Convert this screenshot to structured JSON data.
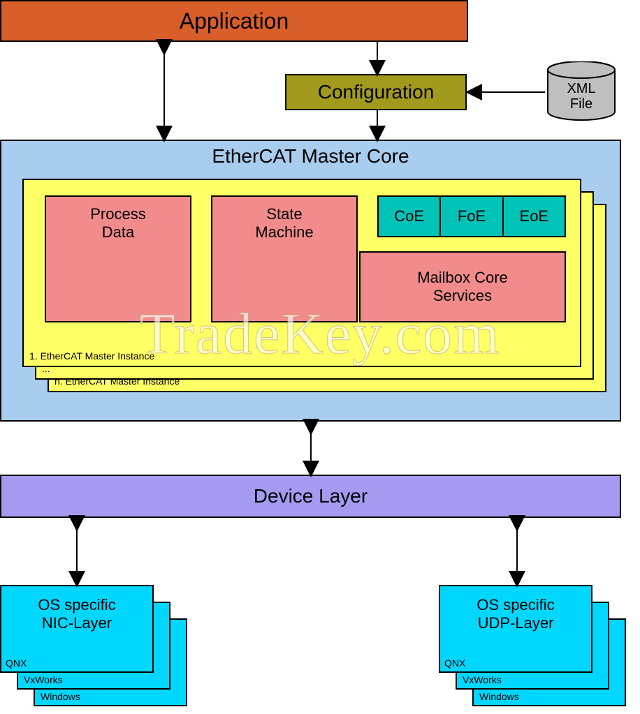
{
  "application": "Application",
  "configuration": "Configuration",
  "xml_file_line1": "XML",
  "xml_file_line2": "File",
  "core": {
    "title": "EtherCAT Master Core",
    "process_data_line1": "Process",
    "process_data_line2": "Data",
    "state_machine_line1": "State",
    "state_machine_line2": "Machine",
    "protocols": [
      "CoE",
      "FoE",
      "EoE"
    ],
    "mailbox_line1": "Mailbox Core",
    "mailbox_line2": "Services",
    "instance_1": "1. EtherCAT Master Instance",
    "instance_dots": "...",
    "instance_n": "n. EtherCAT Master Instance"
  },
  "device_layer": "Device Layer",
  "nic": {
    "title_line1": "OS specific",
    "title_line2": "NIC-Layer",
    "stack": [
      "QNX",
      "VxWorks",
      "Windows"
    ]
  },
  "udp": {
    "title_line1": "OS specific",
    "title_line2": "UDP-Layer",
    "stack": [
      "QNX",
      "VxWorks",
      "Windows"
    ]
  },
  "watermark": "TradeKey.com"
}
